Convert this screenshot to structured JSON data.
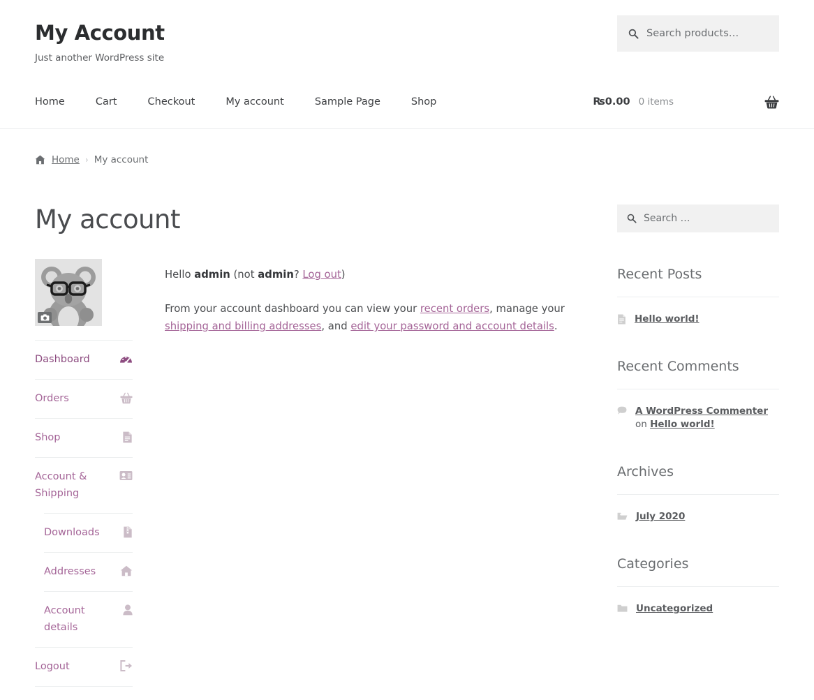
{
  "header": {
    "site_title": "My Account",
    "tagline": "Just another WordPress site",
    "product_search": {
      "placeholder": "Search products…",
      "value": "",
      "icon": "search-icon"
    }
  },
  "nav": {
    "items": [
      {
        "label": "Home"
      },
      {
        "label": "Cart"
      },
      {
        "label": "Checkout"
      },
      {
        "label": "My account"
      },
      {
        "label": "Sample Page"
      },
      {
        "label": "Shop"
      }
    ]
  },
  "cart": {
    "amount": "₨0.00",
    "items_text": "0 items",
    "icon": "shopping-basket-icon"
  },
  "breadcrumb": {
    "home_icon": "home-icon",
    "home_label": "Home",
    "separator": "›",
    "current": "My account"
  },
  "main": {
    "page_title": "My account",
    "avatar": {
      "name": "koala-avatar",
      "camera_badge_icon": "camera-icon"
    },
    "greeting": {
      "prefix": "Hello ",
      "username": "admin",
      "mid": " (not ",
      "username2": "admin",
      "question": "? ",
      "logout_link": "Log out",
      "suffix": ")"
    },
    "dashboard_text": {
      "part1": "From your account dashboard you can view your ",
      "link1": "recent orders",
      "part2": ", manage your ",
      "link2": "shipping and billing addresses",
      "part3": ", and ",
      "link3": "edit your password and account details",
      "part4": "."
    },
    "account_nav": [
      {
        "label": "Dashboard",
        "icon": "dashboard-gauge-icon",
        "active": true
      },
      {
        "label": "Orders",
        "icon": "shopping-basket-icon",
        "active": false
      },
      {
        "label": "Shop",
        "icon": "document-icon",
        "active": false
      },
      {
        "label": "Account & Shipping",
        "icon": "id-card-icon",
        "active": false,
        "children": [
          {
            "label": "Downloads",
            "icon": "file-zip-icon"
          },
          {
            "label": "Addresses",
            "icon": "home-icon"
          },
          {
            "label": "Account details",
            "icon": "user-icon"
          }
        ]
      },
      {
        "label": "Logout",
        "icon": "sign-out-icon",
        "active": false
      }
    ]
  },
  "sidebar": {
    "search": {
      "placeholder": "Search …",
      "value": "",
      "icon": "search-icon"
    },
    "widgets": [
      {
        "title": "Recent Posts",
        "items": [
          {
            "icon": "document-icon",
            "link": "Hello world!"
          }
        ]
      },
      {
        "title": "Recent Comments",
        "items": [
          {
            "icon": "comment-icon",
            "link": "A WordPress Commenter",
            "plain": " on ",
            "link2": "Hello world!"
          }
        ]
      },
      {
        "title": "Archives",
        "items": [
          {
            "icon": "folder-open-icon",
            "link": "July 2020"
          }
        ]
      },
      {
        "title": "Categories",
        "items": [
          {
            "icon": "folder-icon",
            "link": "Uncategorized"
          }
        ]
      }
    ]
  },
  "colors": {
    "link_purple": "#a46497",
    "active_purple": "#8d4c80",
    "text": "#43454b",
    "muted": "#6a6d70",
    "field_bg": "#f1f1f1",
    "divider": "#eceeef"
  }
}
